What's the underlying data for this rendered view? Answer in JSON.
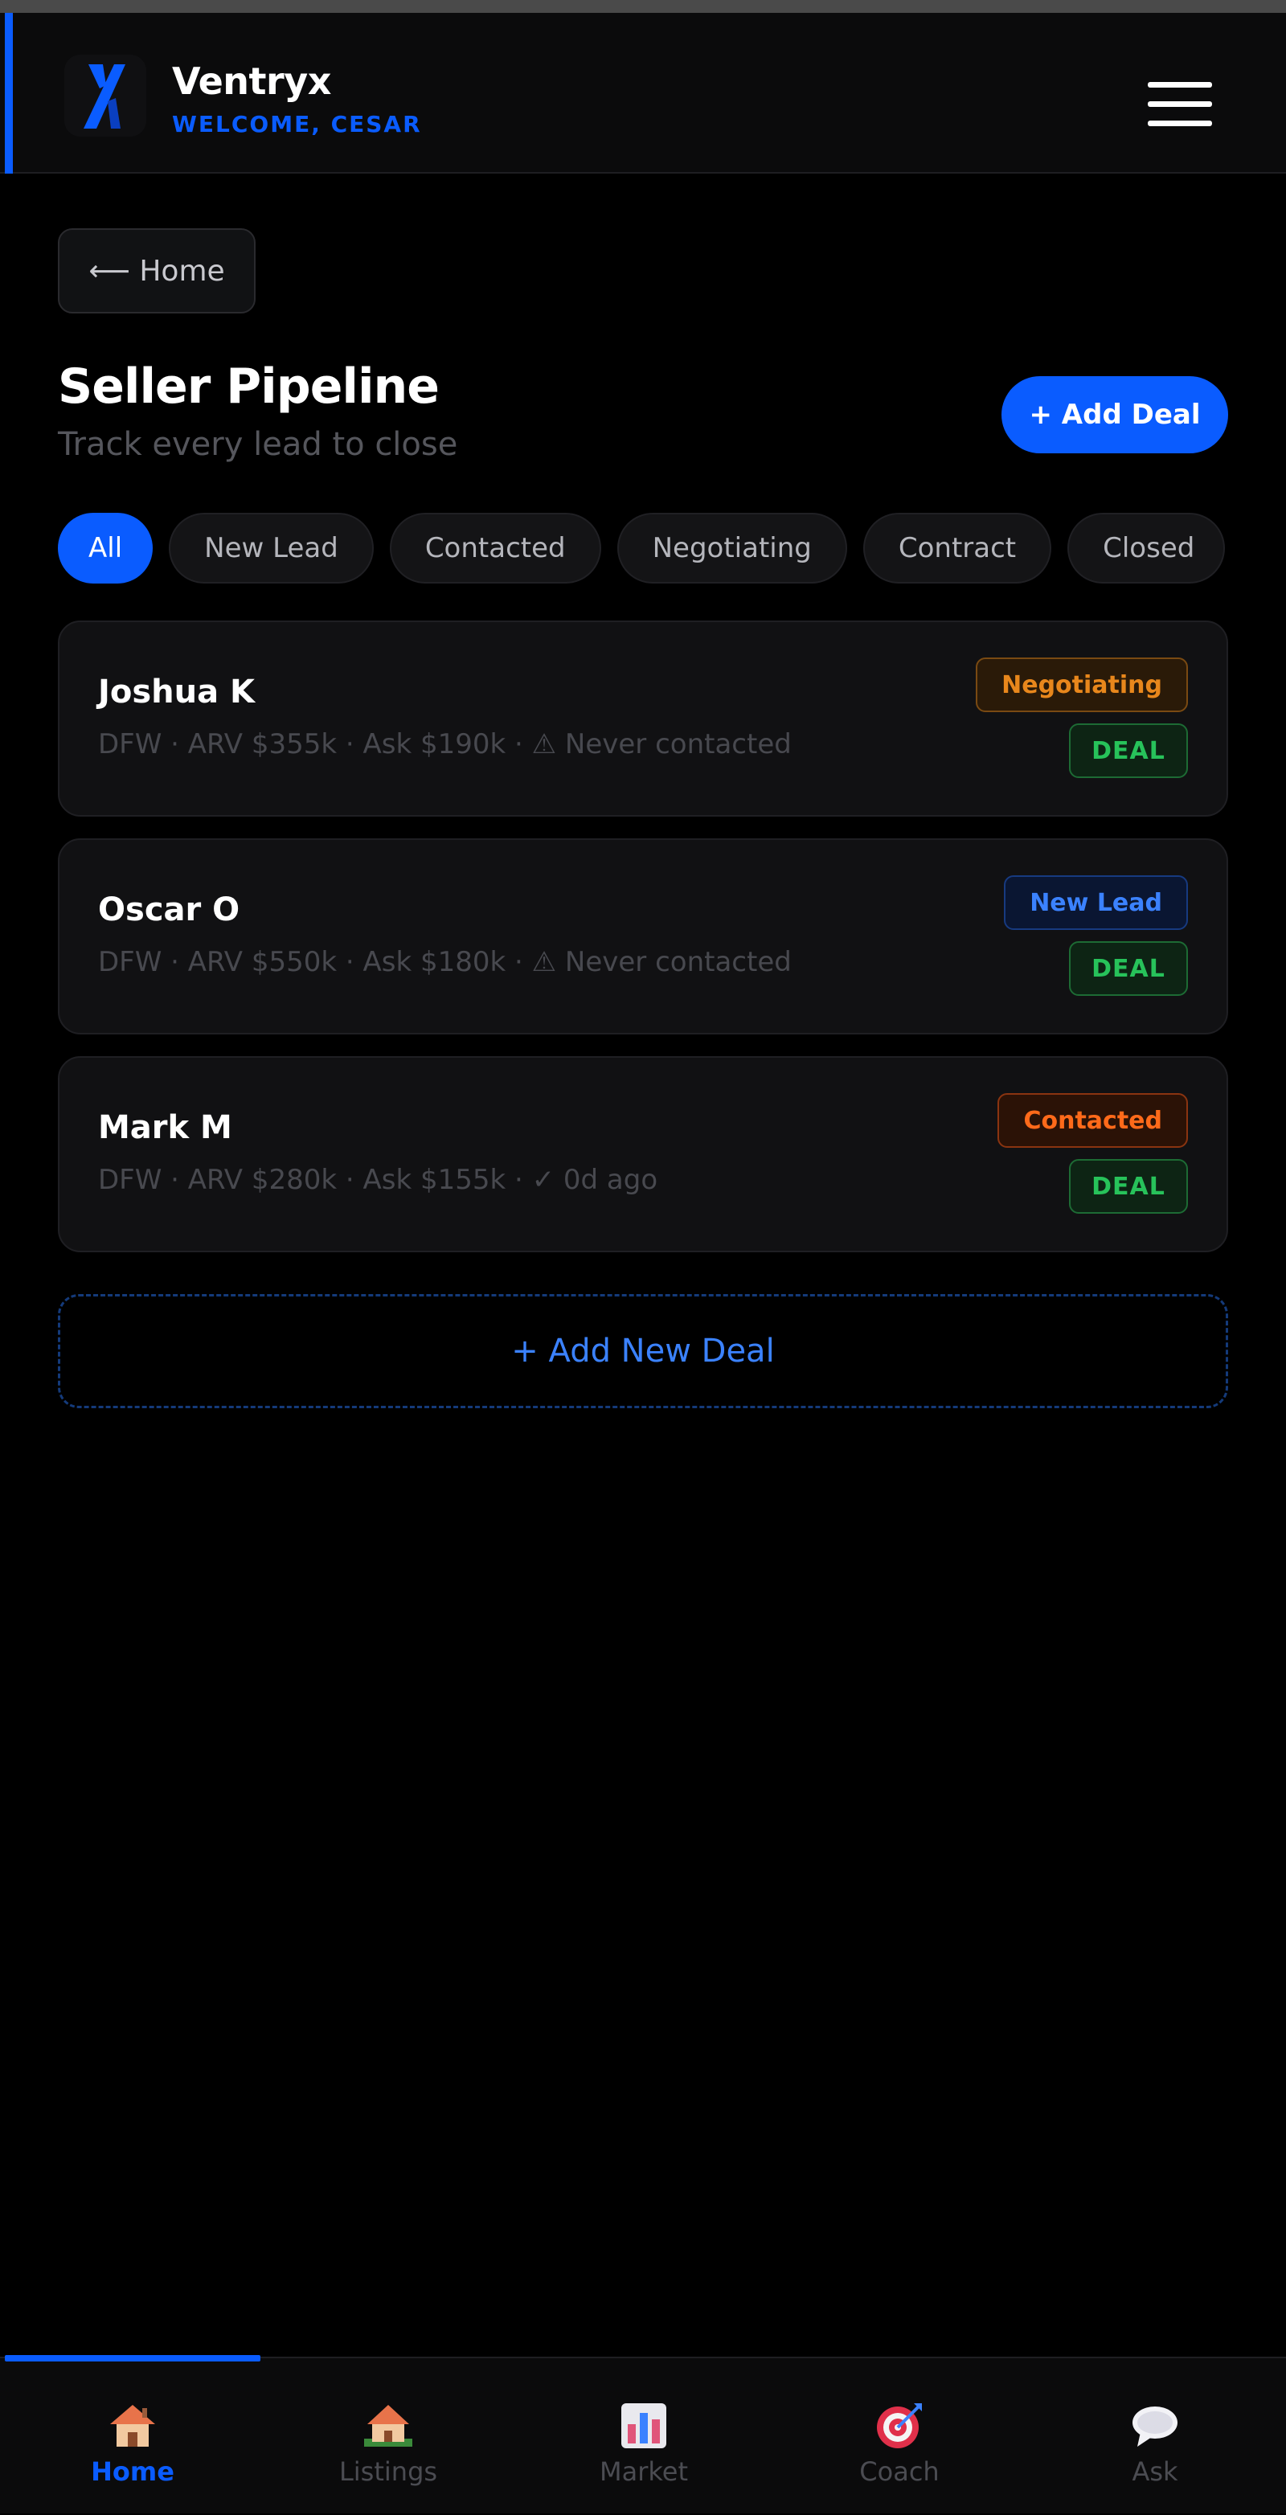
{
  "header": {
    "brand": "Ventryx",
    "welcome": "WELCOME, CESAR"
  },
  "back_button": {
    "label": "⟵ Home"
  },
  "page": {
    "title": "Seller Pipeline",
    "subtitle": "Track every lead to close",
    "add_deal_label": "+ Add Deal"
  },
  "filters": [
    "All",
    "New Lead",
    "Contacted",
    "Negotiating",
    "Contract",
    "Closed"
  ],
  "active_filter": "All",
  "deals": [
    {
      "name": "Joshua K",
      "meta": "DFW · ARV $355k · Ask $190k · ⚠ Never contacted",
      "status": "Negotiating",
      "tag": "DEAL"
    },
    {
      "name": "Oscar O",
      "meta": "DFW · ARV $550k · Ask $180k · ⚠ Never contacted",
      "status": "New Lead",
      "tag": "DEAL"
    },
    {
      "name": "Mark M",
      "meta": "DFW · ARV $280k · Ask $155k · ✓ 0d ago",
      "status": "Contacted",
      "tag": "DEAL"
    }
  ],
  "add_new_deal_label": "+ Add New Deal",
  "nav": [
    {
      "label": "Home",
      "icon": "home-icon",
      "active": true
    },
    {
      "label": "Listings",
      "icon": "listings-icon",
      "active": false
    },
    {
      "label": "Market",
      "icon": "market-chart-icon",
      "active": false
    },
    {
      "label": "Coach",
      "icon": "target-icon",
      "active": false
    },
    {
      "label": "Ask",
      "icon": "chat-bubble-icon",
      "active": false
    }
  ],
  "colors": {
    "accent": "#0a5cff",
    "negotiating": "#e8871c",
    "new_lead": "#3b82ff",
    "contacted": "#ff6a1a",
    "deal": "#27c25a"
  }
}
